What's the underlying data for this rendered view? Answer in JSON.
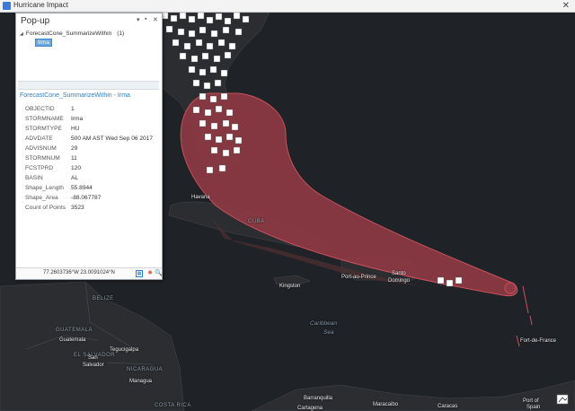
{
  "window": {
    "title": "Hurricane Impact",
    "close_glyph": "✕",
    "app_icon": "arcgis-pro-icon"
  },
  "popup": {
    "title": "Pop-up",
    "controls": {
      "menu_glyph": "▾",
      "pin_glyph": "▪",
      "close_glyph": "✕"
    },
    "tree": {
      "caret_glyph": "◢",
      "layer_name": "ForecastCone_SummarizeWithin",
      "layer_count": "(1)",
      "feature_label": "Irma"
    },
    "feature_header": "ForecastCone_SummarizeWithin - Irma",
    "attributes": [
      {
        "key": "OBJECTID",
        "value": "1"
      },
      {
        "key": "STORMNAME",
        "value": "Irma"
      },
      {
        "key": "STORMTYPE",
        "value": "HU"
      },
      {
        "key": "ADVDATE",
        "value": "500 AM AST Wed Sep 06 2017"
      },
      {
        "key": "ADVISNUM",
        "value": "29"
      },
      {
        "key": "STORMNUM",
        "value": "11"
      },
      {
        "key": "FCSTPRD",
        "value": "120"
      },
      {
        "key": "BASIN",
        "value": "AL"
      },
      {
        "key": "Shape_Length",
        "value": "55.8944"
      },
      {
        "key": "Shape_Area",
        "value": "-88.067787"
      },
      {
        "key": "Count of Points",
        "value": "3523"
      }
    ],
    "coordinates": "77.2603736°W 23.0091024°N",
    "footer_icons": [
      "table-icon",
      "flash-icon",
      "zoom-icon"
    ],
    "footer_glyphs": {
      "table": "▦",
      "flash": "✸",
      "zoom": "🔍"
    }
  },
  "map": {
    "places": {
      "havana": "Havana",
      "cuba": "CUBA",
      "port_au_prince": "Port-au-Prince",
      "santo": "Santo",
      "domingo": "Domingo",
      "kingston": "Kingston",
      "belize": "BELIZE",
      "guatemala_country": "GUATEMALA",
      "guatemala_city": "Guatemala",
      "tegucigalpa": "Tegucigalpa",
      "el_salvador": "EL SALVADOR",
      "san": "San",
      "salvador": "Salvador",
      "nicaragua": "NICARAGUA",
      "managua": "Managua",
      "caribbean": "Caribbean",
      "sea": "Sea",
      "barranquilla": "Barranquilla",
      "cartagena": "Cartagena",
      "maracaibo": "Maracaibo",
      "caracas": "Caracas",
      "port_of_spain_1": "Port of",
      "port_of_spain_2": "Spain",
      "fort_de_france": "Fort-de-France",
      "costa_rica": "COSTA RICA"
    },
    "colors": {
      "ocean": "#1f2226",
      "land": "#2b2d31",
      "cone_fill": "#8f3a44",
      "cone_stroke": "#c9515c",
      "points": "#ffffff"
    },
    "overlay_icon": "basemap-toggle-icon"
  }
}
